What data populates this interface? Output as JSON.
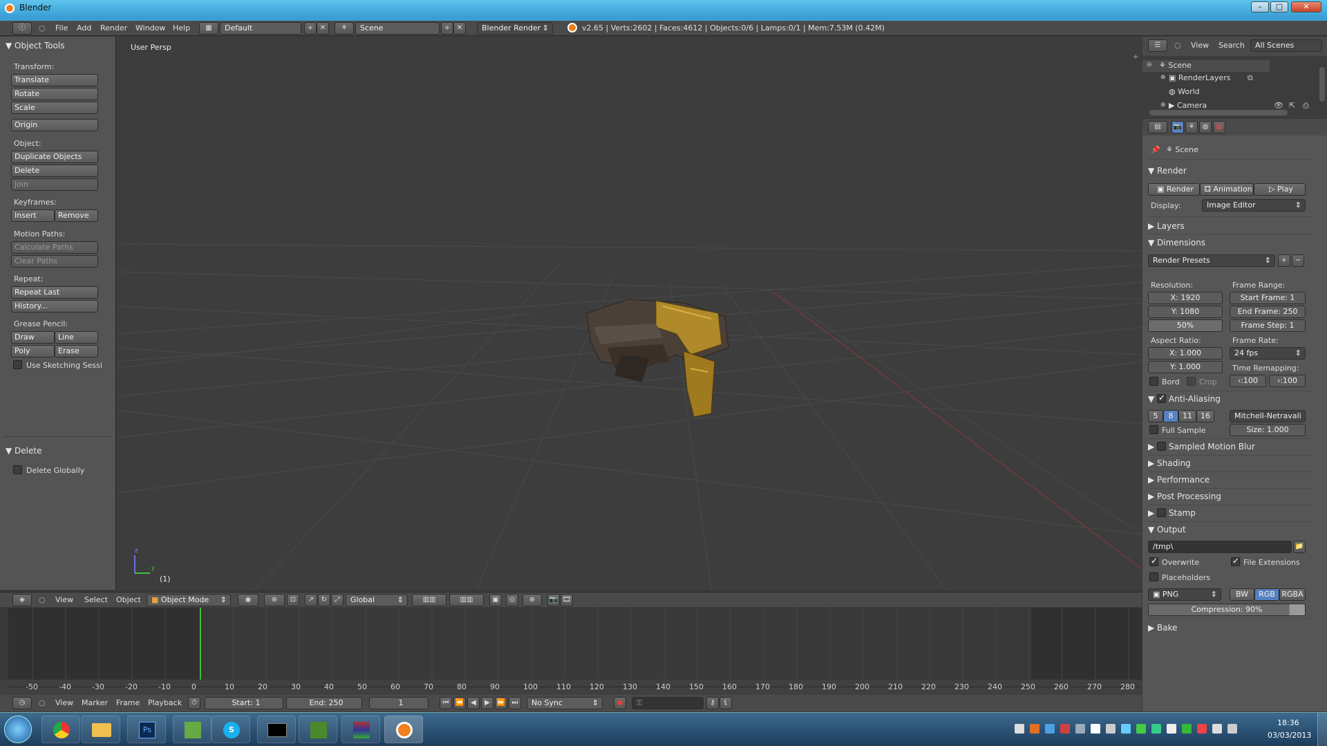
{
  "window": {
    "title": "Blender",
    "minimize": "–",
    "maximize": "□",
    "close": "✕"
  },
  "topbar": {
    "menus": [
      "File",
      "Add",
      "Render",
      "Window",
      "Help"
    ],
    "layout": "Default",
    "scene": "Scene",
    "engine": "Blender Render",
    "stats": "v2.65 | Verts:2602 | Faces:4612 | Objects:0/6 | Lamps:0/1 | Mem:7.53M (0.42M)"
  },
  "toolshelf": {
    "header": "Object Tools",
    "transform_label": "Transform:",
    "translate": "Translate",
    "rotate": "Rotate",
    "scale": "Scale",
    "origin": "Origin",
    "object_label": "Object:",
    "duplicate": "Duplicate Objects",
    "delete": "Delete",
    "join": "Join",
    "keyframes_label": "Keyframes:",
    "insert": "Insert",
    "remove": "Remove",
    "motion_label": "Motion Paths:",
    "calc_paths": "Calculate Paths",
    "clear_paths": "Clear Paths",
    "repeat_label": "Repeat:",
    "repeat_last": "Repeat Last",
    "history": "History...",
    "grease_label": "Grease Pencil:",
    "draw": "Draw",
    "line": "Line",
    "poly": "Poly",
    "erase": "Erase",
    "sketching": "Use Sketching Sessi",
    "op_header": "Delete",
    "delete_globally": "Delete Globally"
  },
  "viewport": {
    "label": "User Persp",
    "frame": "(1)",
    "axis_z": "z",
    "axis_y": "y"
  },
  "v3dheader": {
    "menus": [
      "View",
      "Select",
      "Object"
    ],
    "mode": "Object Mode",
    "orientation": "Global"
  },
  "timeline": {
    "ticks": [
      "-50",
      "-40",
      "-30",
      "-20",
      "-10",
      "0",
      "10",
      "20",
      "30",
      "40",
      "50",
      "60",
      "70",
      "80",
      "90",
      "100",
      "110",
      "120",
      "130",
      "140",
      "150",
      "160",
      "170",
      "180",
      "190",
      "200",
      "210",
      "220",
      "230",
      "240",
      "250",
      "260",
      "270",
      "280"
    ],
    "menus": [
      "View",
      "Marker",
      "Frame",
      "Playback"
    ],
    "start": "Start: 1",
    "end": "End: 250",
    "current": "1",
    "sync": "No Sync"
  },
  "outliner": {
    "menus": [
      "View",
      "Search"
    ],
    "filter": "All Scenes",
    "items": [
      "Scene",
      "RenderLayers",
      "World",
      "Camera"
    ]
  },
  "properties": {
    "context": "Scene",
    "render_section": "Render",
    "render_btn": "Render",
    "animation_btn": "Animation",
    "play_btn": "Play",
    "display_label": "Display:",
    "display_value": "Image Editor",
    "layers": "Layers",
    "dimensions": "Dimensions",
    "presets": "Render Presets",
    "resolution_label": "Resolution:",
    "res_x": "X: 1920",
    "res_y": "Y: 1080",
    "res_pct": "50%",
    "frame_range_label": "Frame Range:",
    "start_frame": "Start Frame: 1",
    "end_frame": "End Frame: 250",
    "frame_step": "Frame Step: 1",
    "aspect_label": "Aspect Ratio:",
    "asp_x": "X: 1.000",
    "asp_y": "Y: 1.000",
    "frame_rate_label": "Frame Rate:",
    "fps": "24 fps",
    "time_remap_label": "Time Remapping:",
    "remap_old": "100",
    "remap_new": "100",
    "bord": "Bord",
    "crop": "Crop",
    "aa_section": "Anti-Aliasing",
    "aa_samples": [
      "5",
      "8",
      "11",
      "16"
    ],
    "aa_filter": "Mitchell-Netravali",
    "full_sample": "Full Sample",
    "aa_size": "Size: 1.000",
    "motion_blur": "Sampled Motion Blur",
    "shading": "Shading",
    "performance": "Performance",
    "post_processing": "Post Processing",
    "stamp": "Stamp",
    "output": "Output",
    "output_path": "/tmp\\",
    "overwrite": "Overwrite",
    "file_ext": "File Extensions",
    "placeholders": "Placeholders",
    "format": "PNG",
    "bw": "BW",
    "rgb": "RGB",
    "rgba": "RGBA",
    "compression": "Compression: 90%",
    "bake": "Bake"
  },
  "taskbar": {
    "time": "18:36",
    "date": "03/03/2013"
  },
  "colors": {
    "accent": "#5680c2",
    "playhead": "#3fbf3f",
    "title_gradient": "#5ec4ee"
  }
}
